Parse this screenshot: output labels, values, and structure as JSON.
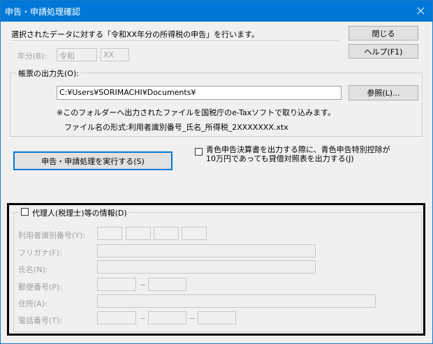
{
  "window": {
    "title": "申告・申請処理確認",
    "close_label": "×"
  },
  "header": {
    "message": "選択されたデータに対する「令和XX年分の所得税の申告」を行います。",
    "close_button": "閉じる",
    "help_button": "ヘルプ(F1)"
  },
  "year": {
    "label": "年分(B):",
    "era": "令和",
    "value": "XX"
  },
  "output": {
    "legend": "帳票の出力先(O):",
    "path": "C:¥Users¥SORIMACHI¥Documents¥",
    "browse_button": "参照(L)...",
    "note": "※このフォルダーへ出力されたファイルを国税庁のe-Taxソフトで取り込みます。",
    "filename_format": "ファイル名の形式:利用者識別番号_氏名_所得税_2XXXXXXX.xtx"
  },
  "execute_button": "申告・申請処理を実行する(S)",
  "blue_return_option": {
    "line1": "青色申告決算書を出力する際に、青色申告特別控除が",
    "line2": "10万円であっても貸借対照表を出力する(J)",
    "checked": false
  },
  "proxy": {
    "legend": "代理人(税理士)等の情報(D)",
    "checked": false,
    "user_id_label": "利用者識別番号(Y):",
    "furigana_label": "フリガナ(F):",
    "name_label": "氏名(N):",
    "postal_label": "郵便番号(P):",
    "address_label": "住所(A):",
    "phone_label": "電話番号(T):",
    "dash": "−"
  }
}
